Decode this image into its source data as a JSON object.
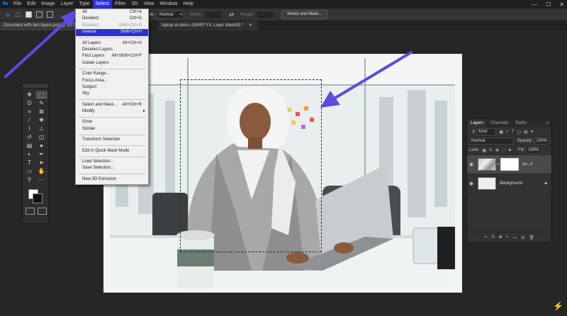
{
  "menubar": {
    "app_logo": "Ps",
    "items": [
      "File",
      "Edit",
      "Image",
      "Layer",
      "Type",
      "Select",
      "Filter",
      "3D",
      "View",
      "Window",
      "Help"
    ],
    "active_index": 5
  },
  "options_bar": {
    "style_label": "Style:",
    "style_value": "Normal",
    "width_label": "Width:",
    "height_label": "Height:",
    "select_and_mask_label": "Select and Mask..."
  },
  "tabs": {
    "tab1": "Document with two layers.psd @ 16.7",
    "tab2": "laptop-at-desk-i-E8NS7YV, Layer Mask/8) *"
  },
  "select_menu": {
    "items": [
      {
        "type": "item",
        "label": "All",
        "shortcut": "Ctrl+A"
      },
      {
        "type": "item",
        "label": "Deselect",
        "shortcut": "Ctrl+D"
      },
      {
        "type": "item",
        "label": "Reselect",
        "shortcut": "Shift+Ctrl+D",
        "disabled": true
      },
      {
        "type": "item",
        "label": "Inverse",
        "shortcut": "Shift+Ctrl+I",
        "highlighted": true
      },
      {
        "type": "sep"
      },
      {
        "type": "item",
        "label": "All Layers",
        "shortcut": "Alt+Ctrl+A"
      },
      {
        "type": "item",
        "label": "Deselect Layers",
        "shortcut": ""
      },
      {
        "type": "item",
        "label": "Find Layers",
        "shortcut": "Alt+Shift+Ctrl+F"
      },
      {
        "type": "item",
        "label": "Isolate Layers",
        "shortcut": ""
      },
      {
        "type": "sep"
      },
      {
        "type": "item",
        "label": "Color Range...",
        "shortcut": ""
      },
      {
        "type": "item",
        "label": "Focus Area...",
        "shortcut": ""
      },
      {
        "type": "item",
        "label": "Subject",
        "shortcut": ""
      },
      {
        "type": "item",
        "label": "Sky",
        "shortcut": ""
      },
      {
        "type": "sep"
      },
      {
        "type": "item",
        "label": "Select and Mask...",
        "shortcut": "Alt+Ctrl+R"
      },
      {
        "type": "item",
        "label": "Modify",
        "shortcut": "",
        "submenu": true
      },
      {
        "type": "sep"
      },
      {
        "type": "item",
        "label": "Grow",
        "shortcut": ""
      },
      {
        "type": "item",
        "label": "Similar",
        "shortcut": ""
      },
      {
        "type": "sep"
      },
      {
        "type": "item",
        "label": "Transform Selection",
        "shortcut": ""
      },
      {
        "type": "sep"
      },
      {
        "type": "item",
        "label": "Edit in Quick Mask Mode",
        "shortcut": ""
      },
      {
        "type": "sep"
      },
      {
        "type": "item",
        "label": "Load Selection...",
        "shortcut": ""
      },
      {
        "type": "item",
        "label": "Save Selection...",
        "shortcut": ""
      },
      {
        "type": "sep"
      },
      {
        "type": "item",
        "label": "New 3D Extrusion",
        "shortcut": ""
      }
    ]
  },
  "layers_panel": {
    "tabs": [
      "Layers",
      "Channels",
      "Paths"
    ],
    "active_tab": 0,
    "kind_label": "Kind",
    "blend_mode": "Normal",
    "opacity_label": "Opacity:",
    "opacity_value": "100%",
    "lock_label": "Lock:",
    "fill_label": "Fill:",
    "fill_value": "100%",
    "layers": [
      {
        "name": "bu...ii",
        "selected": true,
        "has_mask": true
      },
      {
        "name": "Background",
        "selected": false,
        "locked": true
      }
    ],
    "bottom_icons": [
      "link-icon",
      "fx-icon",
      "mask-icon",
      "adjustment-icon",
      "group-icon",
      "new-layer-icon",
      "trash-icon"
    ]
  },
  "colors": {
    "accent": "#2f2fd8",
    "annotation_arrow": "#5b4ce0",
    "background": "#282828"
  }
}
